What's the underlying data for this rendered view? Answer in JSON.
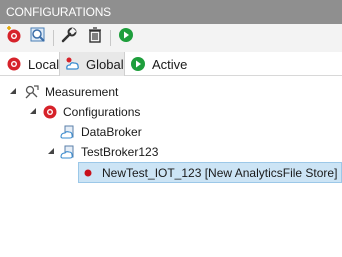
{
  "panel": {
    "title": "CONFIGURATIONS"
  },
  "toolbar": {
    "buttons": [
      {
        "name": "add-configuration-button",
        "icon": "add-record-icon"
      },
      {
        "name": "search-button",
        "icon": "magnifier-icon"
      },
      {
        "name": "settings-button",
        "icon": "wrench-icon"
      },
      {
        "name": "delete-button",
        "icon": "trash-icon"
      },
      {
        "name": "run-button",
        "icon": "play-icon"
      }
    ]
  },
  "tabs": [
    {
      "label": "Local",
      "icon": "record-icon",
      "active": false
    },
    {
      "label": "Global",
      "icon": "cloud-user-icon",
      "active": true
    },
    {
      "label": "Active",
      "icon": "play-icon",
      "active": false
    }
  ],
  "tree": {
    "root": {
      "label": "Measurement",
      "icon": "measurement-icon"
    },
    "configurations": {
      "label": "Configurations",
      "icon": "record-icon"
    },
    "broker1": {
      "label": "DataBroker",
      "icon": "broker-icon"
    },
    "broker2": {
      "label": "TestBroker123",
      "icon": "broker-icon"
    },
    "leaf": {
      "label": "NewTest_IOT_123 [New AnalyticsFile Store]",
      "icon": "red-dot-icon",
      "selected": true
    }
  },
  "colors": {
    "accent_red": "#d6222a",
    "play_green": "#1e9e3c",
    "selection": "#cce4f5",
    "title_bg": "#8f8f8f"
  }
}
